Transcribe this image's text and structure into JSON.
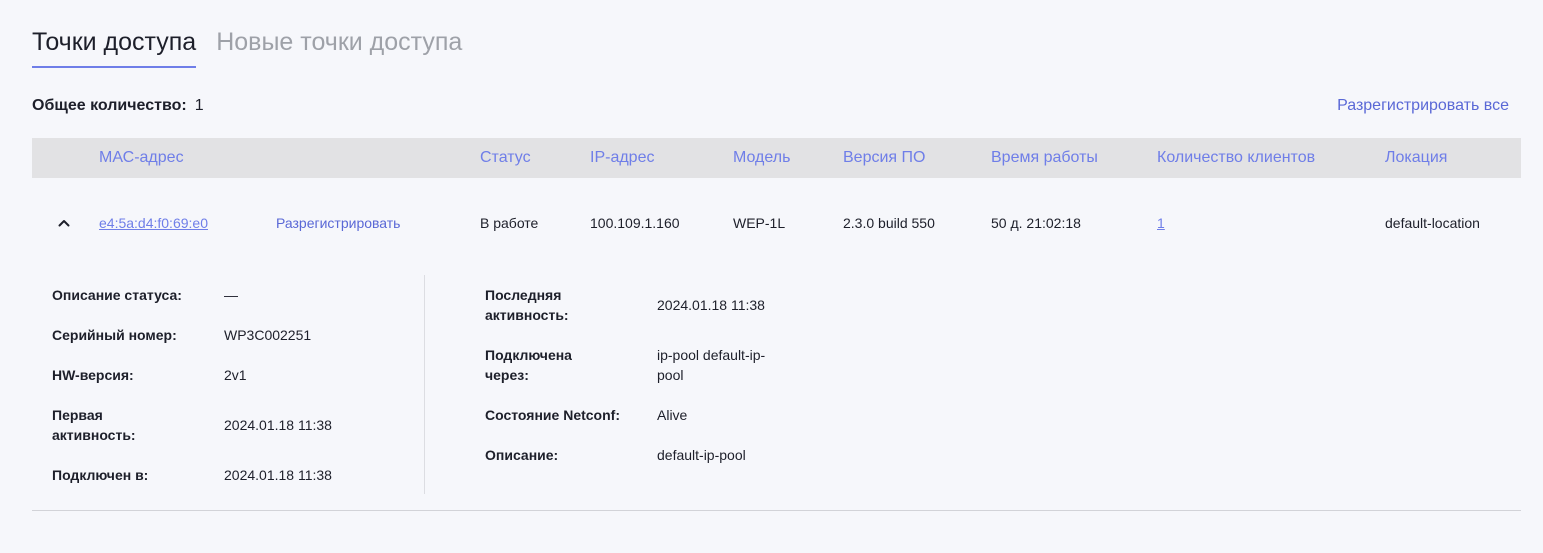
{
  "tabs": {
    "access_points": "Точки доступа",
    "new_access_points": "Новые точки доступа"
  },
  "summary": {
    "label": "Общее количество:",
    "value": "1",
    "deregister_all": "Разрегистрировать все"
  },
  "table": {
    "headers": {
      "mac": "МАС-адрес",
      "status": "Статус",
      "ip": "IP-адрес",
      "model": "Модель",
      "firmware": "Версия ПО",
      "uptime": "Время работы",
      "clients": "Количество клиентов",
      "location": "Локация"
    },
    "row": {
      "mac": "e4:5a:d4:f0:69:e0",
      "deregister": "Разрегистрировать",
      "status": "В работе",
      "ip": "100.109.1.160",
      "model": "WEP-1L",
      "firmware": "2.3.0 build 550",
      "uptime": "50 д. 21:02:18",
      "clients": "1",
      "location": "default-location"
    }
  },
  "details": {
    "left": {
      "status_desc_label": "Описание статуса:",
      "status_desc_value": "—",
      "serial_label": "Серийный номер:",
      "serial_value": "WP3C002251",
      "hw_label": "HW-версия:",
      "hw_value": "2v1",
      "first_active_label_1": "Первая",
      "first_active_label_2": "активность:",
      "first_active_value": "2024.01.18 11:38",
      "connected_at_label": "Подключен в:",
      "connected_at_value": "2024.01.18 11:38"
    },
    "right": {
      "last_active_label_1": "Последняя",
      "last_active_label_2": "активность:",
      "last_active_value": "2024.01.18 11:38",
      "connected_via_label_1": "Подключена",
      "connected_via_label_2": "через:",
      "connected_via_value_1": "ip-pool default-ip-",
      "connected_via_value_2": "pool",
      "netconf_label": "Состояние Netconf:",
      "netconf_value": "Alive",
      "description_label": "Описание:",
      "description_value": "default-ip-pool"
    }
  },
  "colors": {
    "accent": "#6f7ee8",
    "header_bg": "#e2e2e4",
    "page_bg": "#f6f7fb"
  }
}
